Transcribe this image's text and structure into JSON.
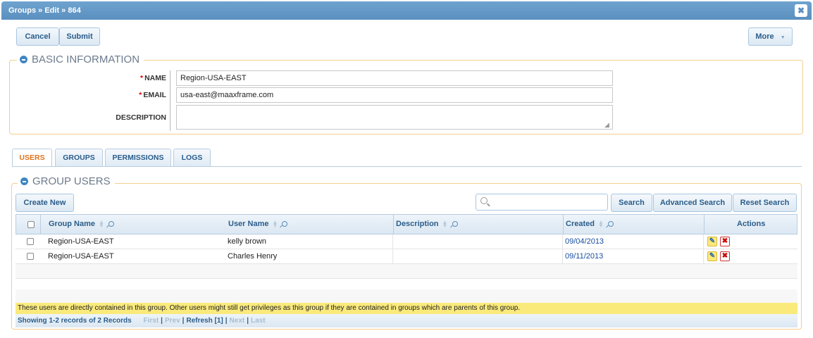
{
  "window": {
    "title": "Groups » Edit » 864",
    "close_glyph": "✖"
  },
  "toolbar": {
    "cancel_label": "Cancel",
    "submit_label": "Submit",
    "more_label": "More",
    "more_arrow": "▼"
  },
  "basic_info": {
    "legend": "BASIC INFORMATION",
    "fields": {
      "name": {
        "label": "NAME",
        "required_mark": "*",
        "value": "Region-USA-EAST"
      },
      "email": {
        "label": "EMAIL",
        "required_mark": "*",
        "value": "usa-east@maaxframe.com"
      },
      "description": {
        "label": "DESCRIPTION",
        "value": ""
      }
    }
  },
  "tabs": [
    {
      "label": "USERS",
      "active": true
    },
    {
      "label": "GROUPS",
      "active": false
    },
    {
      "label": "PERMISSIONS",
      "active": false
    },
    {
      "label": "LOGS",
      "active": false
    }
  ],
  "group_users": {
    "legend": "GROUP USERS",
    "create_new_label": "Create New",
    "search_placeholder": "",
    "search_label": "Search",
    "advanced_search_label": "Advanced Search",
    "reset_search_label": "Reset Search",
    "columns": {
      "group_name": "Group Name",
      "user_name": "User Name",
      "description": "Description",
      "created": "Created",
      "actions": "Actions"
    },
    "rows": [
      {
        "group_name": "Region-USA-EAST",
        "user_name": "kelly brown",
        "description": "",
        "created": "09/04/2013"
      },
      {
        "group_name": "Region-USA-EAST",
        "user_name": "Charles Henry",
        "description": "",
        "created": "09/11/2013"
      }
    ],
    "note": "These users are directly contained in this group. Other users might still get privileges as this group if they are contained in groups which are parents of this group.",
    "pager": {
      "summary": "Showing 1-2 records of 2 Records",
      "first": "First",
      "prev": "Prev",
      "refresh": "Refresh [1]",
      "next": "Next",
      "last": "Last",
      "separator": "|"
    }
  },
  "colors": {
    "titlebar": "#5a8fbf",
    "fieldset_border": "#f2cf8e",
    "active_tab": "#e0721a",
    "link": "#2a5d8a",
    "note_bg": "#faea7c"
  }
}
